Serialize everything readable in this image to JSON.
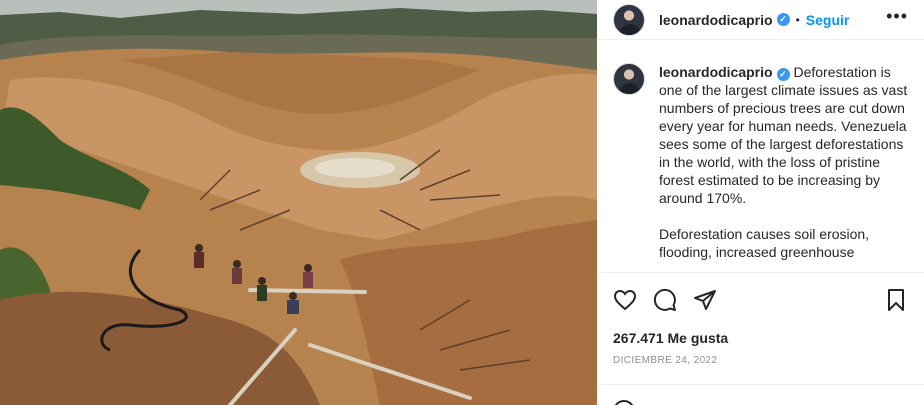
{
  "post": {
    "username": "leonardodicaprio",
    "verified_glyph": "✓",
    "separator": "•",
    "follow_label": "Seguir",
    "more_glyph": "•••",
    "caption_p1": "Deforestation is one of the largest climate issues as vast numbers of precious trees are cut down every year for human needs. Venezuela sees some of the largest deforestations in the world, with the loss of pristine forest estimated to be increasing by around 170%.",
    "caption_p2": "Deforestation causes soil erosion, flooding, increased greenhouse",
    "likes": "267.471 Me gusta",
    "date": "DICIEMBRE 24, 2022"
  },
  "icons": {
    "like": "heart-icon",
    "comment": "comment-icon",
    "share": "paper-plane-icon",
    "save": "bookmark-icon",
    "emoji": "emoji-icon"
  },
  "colors": {
    "accent": "#0095f6",
    "verified": "#3897f0",
    "text": "#262626",
    "muted": "#8e8e8e"
  }
}
